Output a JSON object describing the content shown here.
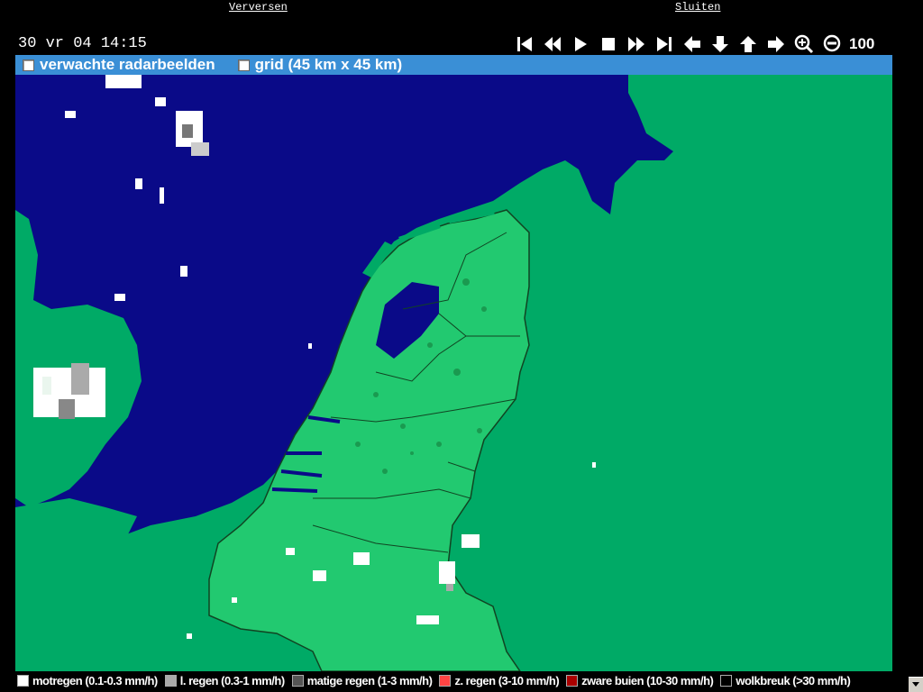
{
  "links": {
    "refresh": "Verversen",
    "close": "Sluiten"
  },
  "timestamp": "30 vr 04 14:15",
  "toolbar": {
    "buttons": [
      {
        "name": "first-frame-icon"
      },
      {
        "name": "rewind-icon"
      },
      {
        "name": "play-icon"
      },
      {
        "name": "stop-icon"
      },
      {
        "name": "fast-forward-icon"
      },
      {
        "name": "last-frame-icon"
      },
      {
        "name": "pan-left-icon"
      },
      {
        "name": "pan-down-icon"
      },
      {
        "name": "pan-up-icon"
      },
      {
        "name": "pan-right-icon"
      },
      {
        "name": "zoom-in-icon"
      },
      {
        "name": "zoom-out-icon"
      }
    ],
    "zoom_level": "100"
  },
  "options": {
    "forecast_label": "verwachte radarbeelden",
    "forecast_checked": false,
    "grid_label": "grid (45 km x 45 km)",
    "grid_checked": false
  },
  "colors": {
    "sea": "#0a0a88",
    "land": "#00aa66",
    "netherlands_belgium": "#22c970",
    "optionbar": "#3a8fd6"
  },
  "legend": [
    {
      "label": "motregen (0.1-0.3 mm/h)",
      "color": "#ffffff"
    },
    {
      "label": "l. regen (0.3-1 mm/h)",
      "color": "#aaaaaa"
    },
    {
      "label": "matige regen (1-3 mm/h)",
      "color": "#555555"
    },
    {
      "label": "z. regen (3-10 mm/h)",
      "color": "#ff4444"
    },
    {
      "label": "zware buien (10-30 mm/h)",
      "color": "#aa0000"
    },
    {
      "label": "wolkbreuk (>30 mm/h)",
      "color": "#000000"
    }
  ]
}
